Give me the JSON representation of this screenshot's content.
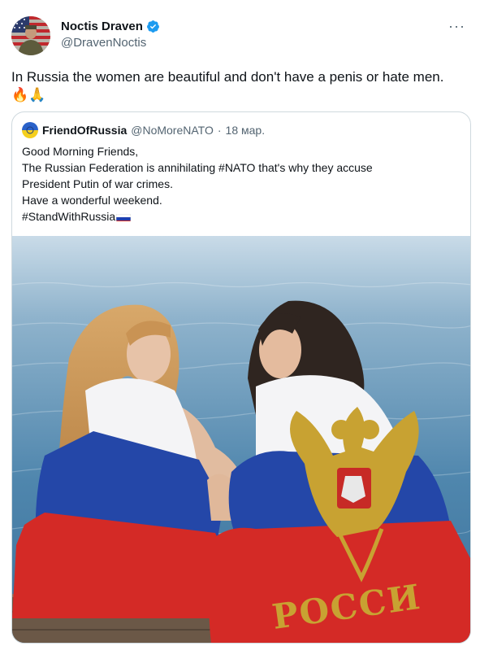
{
  "author": {
    "display_name": "Noctis Draven",
    "handle": "@DravenNoctis",
    "verified": true
  },
  "more_label": "···",
  "tweet": {
    "text": "In Russia the women are beautiful and don't have a penis or hate men.",
    "emojis": "🔥🙏"
  },
  "quoted": {
    "display_name": "FriendOfRussia",
    "handle": "@NoMoreNATO",
    "separator": "·",
    "date": "18 мар.",
    "lines": [
      "Good Morning Friends,",
      "The Russian Federation is annihilating #NATO that's why they accuse",
      "President Putin of war crimes.",
      "Have a wonderful weekend.",
      "#StandWithRussia"
    ],
    "image_text": "РОССИ"
  },
  "colors": {
    "verified_blue": "#1d9bf0",
    "text_primary": "#0f1419",
    "text_secondary": "#536471",
    "border": "#cfd9de"
  }
}
